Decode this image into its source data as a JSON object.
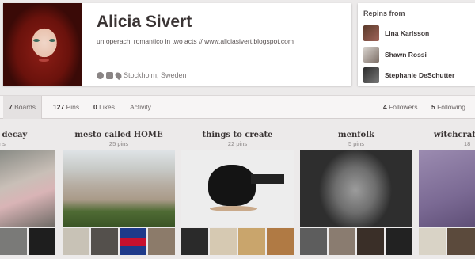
{
  "profile": {
    "name": "Alicia Sivert",
    "bio": "un operachi romantico in two acts // www.aliciasivert.blogspot.com",
    "location": "Stockholm, Sweden"
  },
  "repins": {
    "title": "Repins from",
    "users": [
      {
        "name": "Lina Karlsson"
      },
      {
        "name": "Shawn Rossi"
      },
      {
        "name": "Stephanie DeSchutter"
      }
    ]
  },
  "stats": {
    "boards_count": "7",
    "boards_label": "Boards",
    "pins_count": "127",
    "pins_label": "Pins",
    "likes_count": "0",
    "likes_label": "Likes",
    "activity_label": "Activity",
    "followers_count": "4",
    "followers_label": "Followers",
    "following_count": "5",
    "following_label": "Following"
  },
  "boards": [
    {
      "title": "& decay",
      "count": "pins"
    },
    {
      "title": "mesto called HOME",
      "count": "25 pins"
    },
    {
      "title": "things to create",
      "count": "22 pins"
    },
    {
      "title": "menfolk",
      "count": "5 pins"
    },
    {
      "title": "witchcraft",
      "count": "18"
    }
  ]
}
